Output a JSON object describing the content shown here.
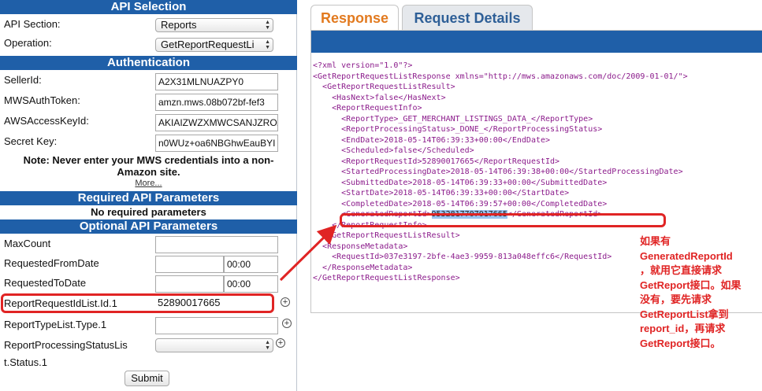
{
  "sections": {
    "api_selection": "API Selection",
    "authentication": "Authentication",
    "required": "Required API Parameters",
    "optional": "Optional API Parameters"
  },
  "api_section": {
    "label": "API Section:",
    "value": "Reports"
  },
  "operation": {
    "label": "Operation:",
    "value": "GetReportRequestLi"
  },
  "auth": {
    "seller_id": {
      "label": "SellerId:",
      "value": "A2X31MLNUAZPY0"
    },
    "mws_auth_token": {
      "label": "MWSAuthToken:",
      "value": "amzn.mws.08b072bf-fef3"
    },
    "aws_access_key": {
      "label": "AWSAccessKeyId:",
      "value": "AKIAIZWZXMWCSANJZRO/"
    },
    "secret_key": {
      "label": "Secret Key:",
      "value": "n0WUz+oa6NBGhwEauBYI"
    },
    "note_line1": "Note: Never enter your MWS credentials into a non-",
    "note_line2": "Amazon site.",
    "more": "More..."
  },
  "required_text": "No required parameters",
  "optional": {
    "max_count": {
      "label": "MaxCount",
      "value": ""
    },
    "requested_from": {
      "label": "RequestedFromDate",
      "value": "",
      "time": "00:00"
    },
    "requested_to": {
      "label": "RequestedToDate",
      "value": "",
      "time": "00:00"
    },
    "report_request_id": {
      "label": "ReportRequestIdList.Id.1",
      "value": "52890017665"
    },
    "report_type": {
      "label": "ReportTypeList.Type.1",
      "value": ""
    },
    "processing_status": {
      "label_line1": "ReportProcessingStatusLis",
      "label_line2": "t.Status.1",
      "value": ""
    }
  },
  "submit_label": "Submit",
  "tabs": {
    "response": "Response",
    "request_details": "Request Details"
  },
  "xml": {
    "decl": "<?xml version=\"1.0\"?>",
    "root_open": "<GetReportRequestListResponse xmlns=\"http://mws.amazonaws.com/doc/2009-01-01/\">",
    "result_open": "<GetReportRequestListResult>",
    "has_next": "<HasNext>false</HasNext>",
    "info_open": "<ReportRequestInfo>",
    "report_type": "<ReportType>_GET_MERCHANT_LISTINGS_DATA_</ReportType>",
    "status": "<ReportProcessingStatus>_DONE_</ReportProcessingStatus>",
    "end_date": "<EndDate>2018-05-14T06:39:33+00:00</EndDate>",
    "scheduled": "<Scheduled>false</Scheduled>",
    "request_id": "<ReportRequestId>52890017665</ReportRequestId>",
    "started": "<StartedProcessingDate>2018-05-14T06:39:38+00:00</StartedProcessingDate>",
    "submitted": "<SubmittedDate>2018-05-14T06:39:33+00:00</SubmittedDate>",
    "start_date": "<StartDate>2018-05-14T06:39:33+00:00</StartDate>",
    "completed": "<CompletedDate>2018-05-14T06:39:57+00:00</CompletedDate>",
    "gen_open": "<GeneratedReportId>",
    "gen_value": "9532817707017665",
    "gen_close": "</GeneratedReportId>",
    "info_close": "</ReportRequestInfo>",
    "result_close": "</GetReportRequestListResult>",
    "meta_open": "<ResponseMetadata>",
    "meta_request": "<RequestId>037e3197-2bfe-4ae3-9959-813a048effc6</RequestId>",
    "meta_close": "</ResponseMetadata>",
    "root_close": "</GetReportRequestListResponse>"
  },
  "annotation": {
    "l1": "如果有",
    "l2": "GeneratedReportId",
    "l3": "，就用它直接请求",
    "l4": "GetReport接口。如果",
    "l5": "没有，要先请求",
    "l6": "GetReportList拿到",
    "l7": "report_id，再请求",
    "l8": "GetReport接口。"
  },
  "colors": {
    "header_blue": "#1f5fa8",
    "highlight_red": "#e02424",
    "tab_orange": "#e27a1f",
    "xml_tag": "#8b1b8b"
  }
}
